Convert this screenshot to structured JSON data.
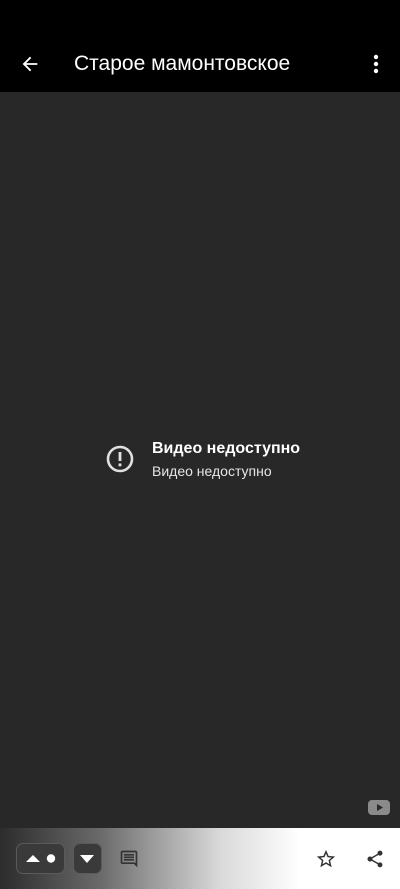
{
  "header": {
    "title": "Старое мамонтовское"
  },
  "player": {
    "error_title": "Видео недоступно",
    "error_subtitle": "Видео недоступно"
  },
  "icons": {
    "back": "arrow-back-icon",
    "menu": "more-vert-icon",
    "error": "error-outline-icon",
    "youtube": "youtube-icon",
    "upvote": "arrow-up-icon",
    "downvote": "arrow-down-icon",
    "comments": "comment-icon",
    "favorite": "star-outline-icon",
    "share": "share-icon"
  },
  "colors": {
    "top_bar_bg": "#000000",
    "player_bg": "#282828",
    "text": "#ffffff"
  }
}
